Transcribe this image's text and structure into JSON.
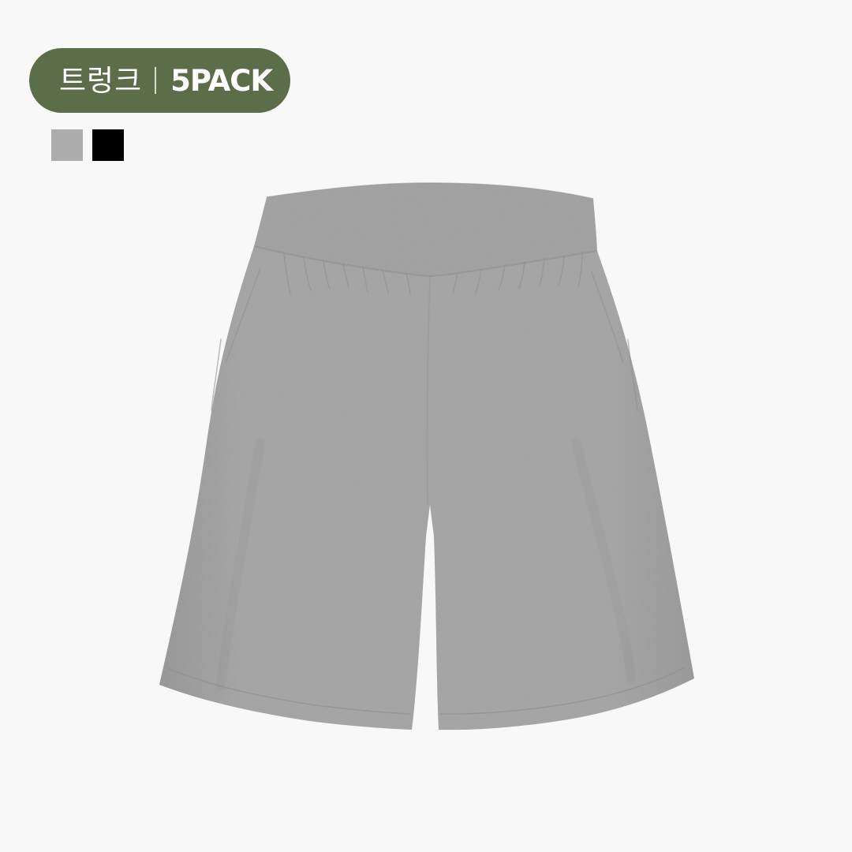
{
  "badge": {
    "type_label": "트렁크",
    "pack_label": "5PACK",
    "background_color": "#5c6d4a"
  },
  "colors": {
    "swatches": [
      {
        "name": "grey",
        "hex": "#acacac"
      },
      {
        "name": "black",
        "hex": "#000000"
      }
    ]
  },
  "product": {
    "image": "grey-trunk-shorts",
    "fabric_color": "#a9a9a9",
    "waistband_color": "#a6a6a6"
  }
}
